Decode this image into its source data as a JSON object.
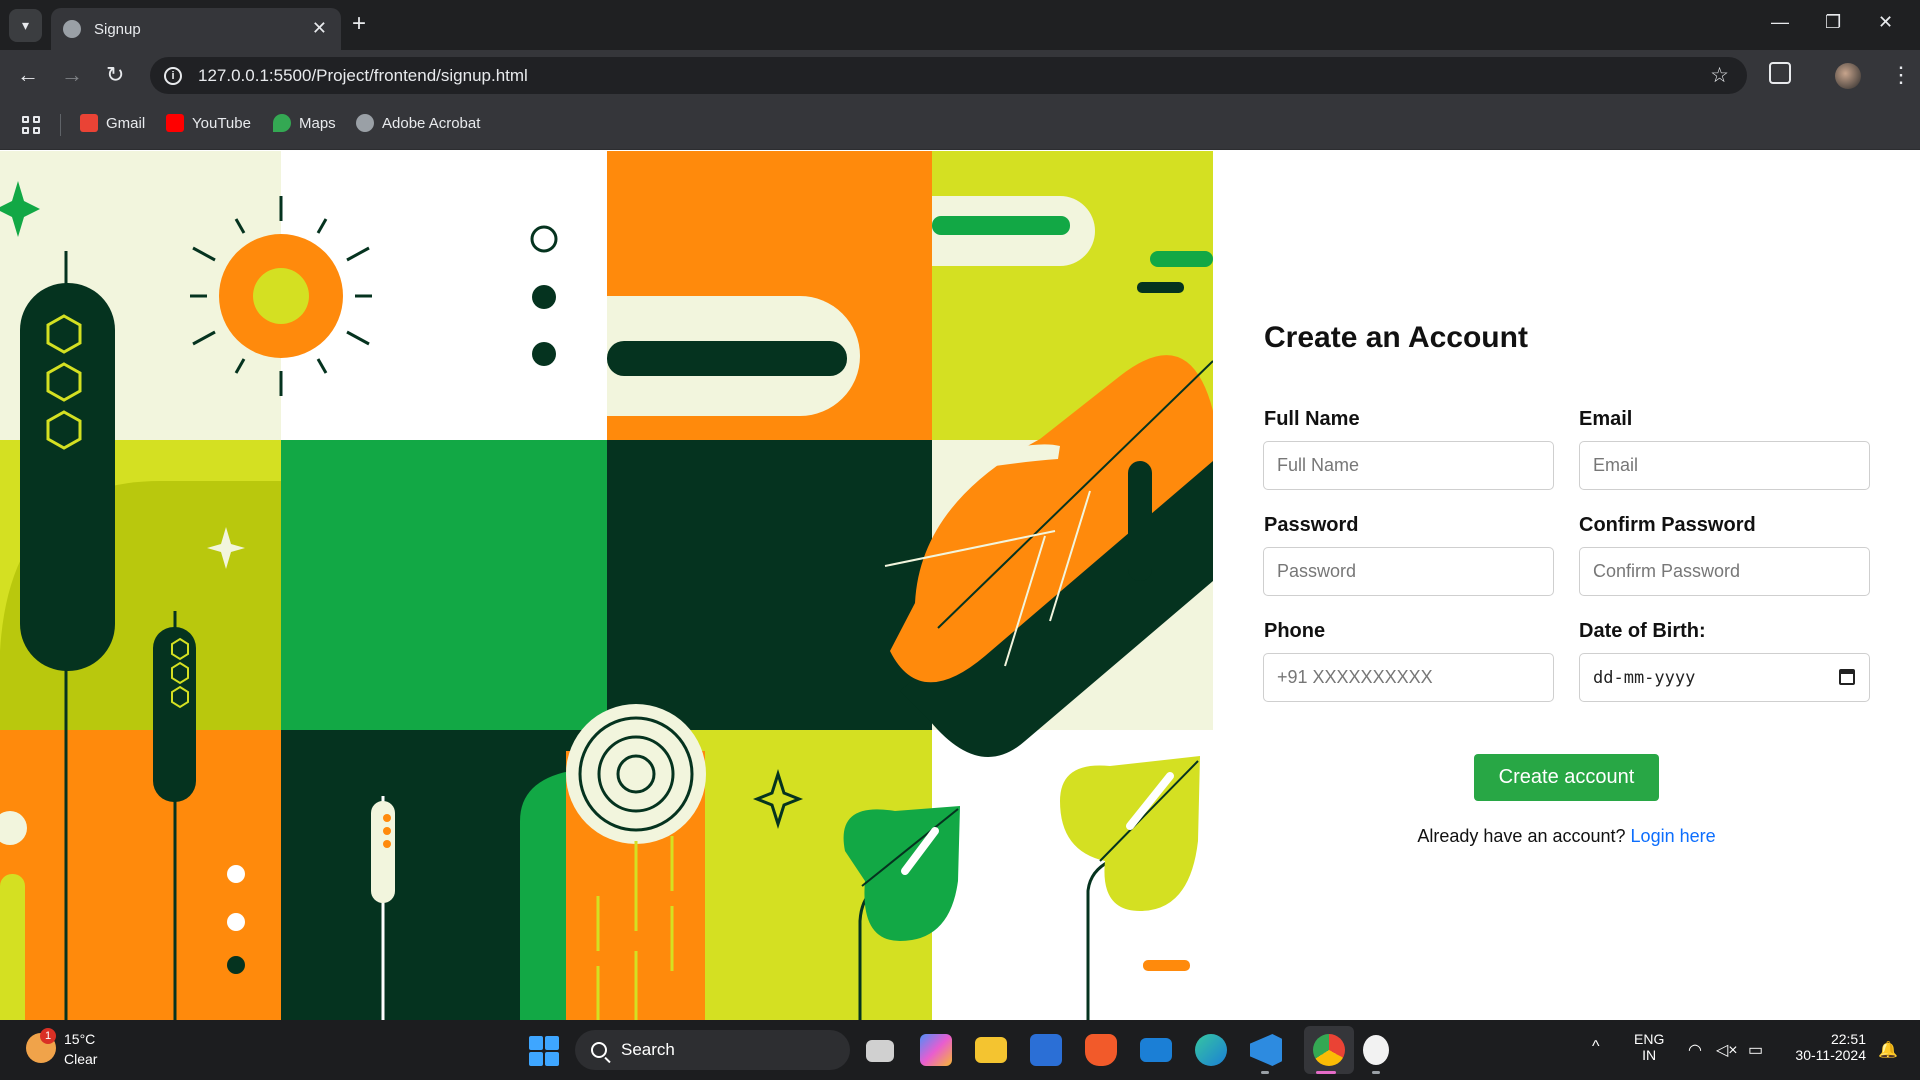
{
  "browser": {
    "tab_title": "Signup",
    "url": "127.0.0.1:5500/Project/frontend/signup.html",
    "bookmarks": [
      {
        "label": "Gmail",
        "icon": "gmail-icon",
        "color": "#ea4335"
      },
      {
        "label": "YouTube",
        "icon": "youtube-icon",
        "color": "#ff0000"
      },
      {
        "label": "Maps",
        "icon": "maps-icon",
        "color": "#34a853"
      },
      {
        "label": "Adobe Acrobat",
        "icon": "globe-icon",
        "color": "#9aa0a6"
      }
    ]
  },
  "form": {
    "title": "Create an Account",
    "fields": {
      "full_name": {
        "label": "Full Name",
        "placeholder": "Full Name"
      },
      "email": {
        "label": "Email",
        "placeholder": "Email"
      },
      "password": {
        "label": "Password",
        "placeholder": "Password"
      },
      "confirm_password": {
        "label": "Confirm Password",
        "placeholder": "Confirm Password"
      },
      "phone": {
        "label": "Phone",
        "placeholder": "+91 XXXXXXXXXX"
      },
      "dob": {
        "label": "Date of Birth:",
        "value": "dd-mm-yyyy"
      }
    },
    "submit_label": "Create account",
    "login_prompt": "Already have an account?",
    "login_link": "Login here"
  },
  "colors": {
    "accent_green": "#28a745",
    "link_blue": "#0d6efd",
    "art_orange": "#ff8a0c",
    "art_dark_green": "#05331f",
    "art_green": "#12a845",
    "art_lime": "#d4e022",
    "art_cream": "#f2f5dd"
  },
  "taskbar": {
    "weather_temp": "15°C",
    "weather_desc": "Clear",
    "weather_badge": "1",
    "search_label": "Search",
    "lang_top": "ENG",
    "lang_bottom": "IN",
    "time": "22:51",
    "date": "30-11-2024"
  }
}
